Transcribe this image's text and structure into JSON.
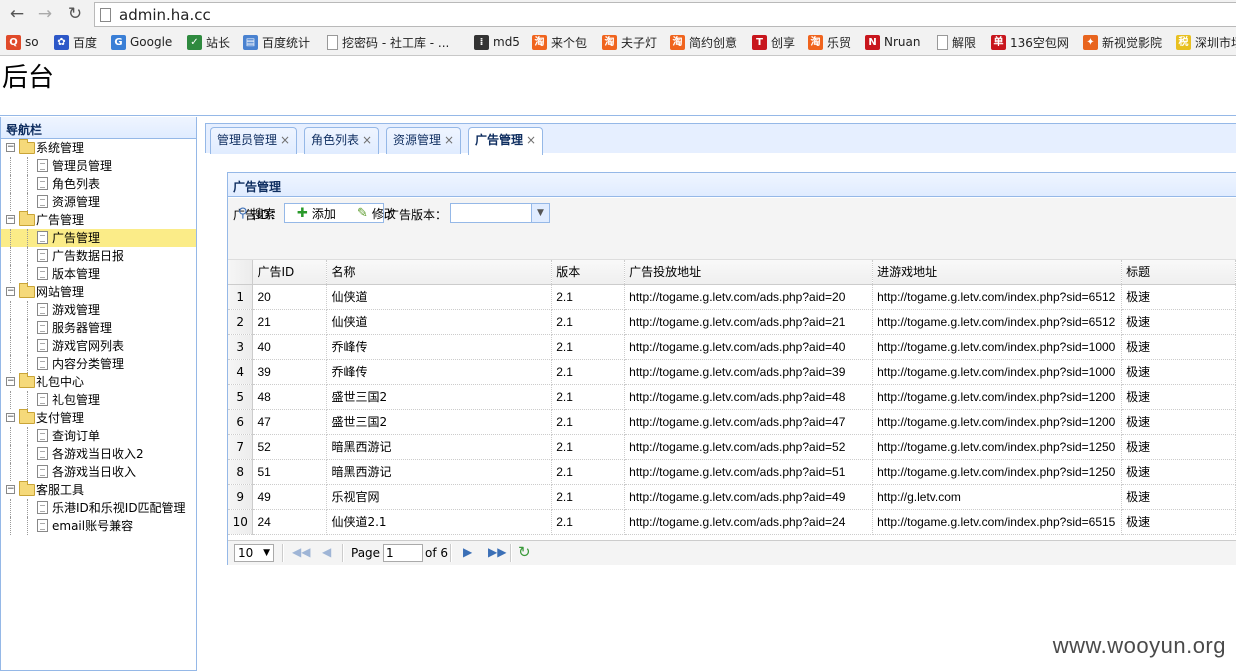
{
  "browser": {
    "url": "admin.ha.cc",
    "bookmarks": [
      {
        "label": "so",
        "icon": "search-icon",
        "color": "#e04a2a"
      },
      {
        "label": "百度",
        "icon": "baidu-paw-icon",
        "color": "#2d58c8"
      },
      {
        "label": "Google",
        "icon": "google-icon",
        "color": "#3a7fd6"
      },
      {
        "label": "站长",
        "icon": "cnzz-icon",
        "color": "#2f8a3f"
      },
      {
        "label": "百度统计",
        "icon": "chart-icon",
        "color": "#4a82d0"
      },
      {
        "label": "挖密码 - 社工库 - ...",
        "icon": "page-icon",
        "color": "#999999"
      },
      {
        "label": "md5",
        "icon": "grid-icon",
        "color": "#333333"
      },
      {
        "label": "来个包",
        "icon": "taobao-icon",
        "color": "#f0641e"
      },
      {
        "label": "夫子灯",
        "icon": "taobao-icon",
        "color": "#f0641e"
      },
      {
        "label": "简约创意",
        "icon": "taobao-icon",
        "color": "#f0641e"
      },
      {
        "label": "创享",
        "icon": "t-icon",
        "color": "#c8161d"
      },
      {
        "label": "乐贸",
        "icon": "taobao-icon",
        "color": "#f0641e"
      },
      {
        "label": "Nruan",
        "icon": "n-icon",
        "color": "#c8161d"
      },
      {
        "label": "解限",
        "icon": "page-icon",
        "color": "#999999"
      },
      {
        "label": "136空包网",
        "icon": "dan-icon",
        "color": "#c8161d"
      },
      {
        "label": "新视觉影院",
        "icon": "film-icon",
        "color": "#e8641e"
      },
      {
        "label": "深圳市场",
        "icon": "tax-icon",
        "color": "#e8c020"
      }
    ]
  },
  "header": {
    "title": "后台"
  },
  "sidebar": {
    "title": "导航栏",
    "groups": [
      {
        "label": "系统管理",
        "items": [
          "管理员管理",
          "角色列表",
          "资源管理"
        ]
      },
      {
        "label": "广告管理",
        "items": [
          "广告管理",
          "广告数据日报",
          "版本管理"
        ]
      },
      {
        "label": "网站管理",
        "items": [
          "游戏管理",
          "服务器管理",
          "游戏官网列表",
          "内容分类管理"
        ]
      },
      {
        "label": "礼包中心",
        "items": [
          "礼包管理"
        ]
      },
      {
        "label": "支付管理",
        "items": [
          "查询订单",
          "各游戏当日收入2",
          "各游戏当日收入"
        ]
      },
      {
        "label": "客服工具",
        "items": [
          "乐港ID和乐视ID匹配管理",
          "email账号兼容"
        ]
      }
    ],
    "selected": "广告管理"
  },
  "tabs": [
    {
      "label": "管理员管理",
      "active": false
    },
    {
      "label": "角色列表",
      "active": false
    },
    {
      "label": "资源管理",
      "active": false
    },
    {
      "label": "广告管理",
      "active": true
    }
  ],
  "panel": {
    "title": "广告管理",
    "filters": {
      "ad_id_label": "广告ID：",
      "ad_id_value": "",
      "version_label": "广告版本：",
      "version_value": ""
    },
    "buttons": {
      "search": "搜索",
      "add": "添加",
      "edit": "修改"
    },
    "columns": [
      "广告ID",
      "名称",
      "版本",
      "广告投放地址",
      "进游戏地址",
      "标题"
    ],
    "rows": [
      [
        "20",
        "仙侠道",
        "2.1",
        "http://togame.g.letv.com/ads.php?aid=20",
        "http://togame.g.letv.com/index.php?sid=6512",
        "极速"
      ],
      [
        "21",
        "仙侠道",
        "2.1",
        "http://togame.g.letv.com/ads.php?aid=21",
        "http://togame.g.letv.com/index.php?sid=6512",
        "极速"
      ],
      [
        "40",
        "乔峰传",
        "2.1",
        "http://togame.g.letv.com/ads.php?aid=40",
        "http://togame.g.letv.com/index.php?sid=1000",
        "极速"
      ],
      [
        "39",
        "乔峰传",
        "2.1",
        "http://togame.g.letv.com/ads.php?aid=39",
        "http://togame.g.letv.com/index.php?sid=1000",
        "极速"
      ],
      [
        "48",
        "盛世三国2",
        "2.1",
        "http://togame.g.letv.com/ads.php?aid=48",
        "http://togame.g.letv.com/index.php?sid=1200",
        "极速"
      ],
      [
        "47",
        "盛世三国2",
        "2.1",
        "http://togame.g.letv.com/ads.php?aid=47",
        "http://togame.g.letv.com/index.php?sid=1200",
        "极速"
      ],
      [
        "52",
        "暗黑西游记",
        "2.1",
        "http://togame.g.letv.com/ads.php?aid=52",
        "http://togame.g.letv.com/index.php?sid=1250",
        "极速"
      ],
      [
        "51",
        "暗黑西游记",
        "2.1",
        "http://togame.g.letv.com/ads.php?aid=51",
        "http://togame.g.letv.com/index.php?sid=1250",
        "极速"
      ],
      [
        "49",
        "乐视官网",
        "2.1",
        "http://togame.g.letv.com/ads.php?aid=49",
        "http://g.letv.com",
        "极速"
      ],
      [
        "24",
        "仙侠道2.1",
        "2.1",
        "http://togame.g.letv.com/ads.php?aid=24",
        "http://togame.g.letv.com/index.php?sid=6515",
        "极速"
      ]
    ],
    "row_numbers": [
      "1",
      "2",
      "3",
      "4",
      "5",
      "6",
      "7",
      "8",
      "9",
      "10"
    ],
    "pager": {
      "page_size": "10",
      "page_label": "Page",
      "current_page": "1",
      "total_label": "of 6"
    }
  },
  "watermark": "www.wooyun.org"
}
